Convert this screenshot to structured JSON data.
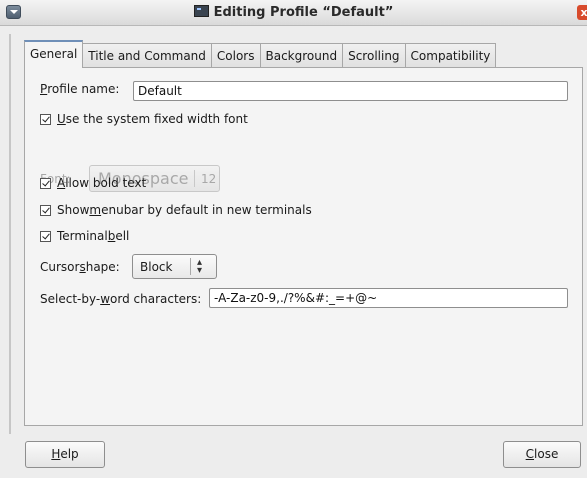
{
  "window": {
    "title": "Editing Profile “Default”",
    "close_glyph": "x"
  },
  "tabs": [
    "General",
    "Title and Command",
    "Colors",
    "Background",
    "Scrolling",
    "Compatibility"
  ],
  "general": {
    "profile_name_label_mn": "P",
    "profile_name_label_rest": "rofile name:",
    "profile_name_value": "Default",
    "system_font_pre": "",
    "system_font_mn": "U",
    "system_font_rest": "se the system fixed width font",
    "font_label_mn": "F",
    "font_label_rest": "ont:",
    "font_name": "Monospace",
    "font_size": "12",
    "bold_mn": "A",
    "bold_rest": "llow bold text",
    "menubar_pre": "Show ",
    "menubar_mn": "m",
    "menubar_rest": "enubar by default in new terminals",
    "bell_pre": "Terminal ",
    "bell_mn": "b",
    "bell_rest": "ell",
    "cursor_pre": "Cursor ",
    "cursor_mn": "s",
    "cursor_rest": "hape:",
    "cursor_value": "Block",
    "word_pre": "Select-by-",
    "word_mn": "w",
    "word_rest": "ord characters:",
    "word_value": "-A-Za-z0-9,./?%&#:_=+@~"
  },
  "checkbox_states": {
    "system_font": true,
    "bold": true,
    "menubar": true,
    "bell": true
  },
  "buttons": {
    "help_mn": "H",
    "help_rest": "elp",
    "close_mn": "C",
    "close_rest": "lose"
  },
  "icons": [
    "window-menu-icon",
    "terminal-icon",
    "close-icon",
    "checkbox-icon",
    "updown-arrows-icon"
  ]
}
